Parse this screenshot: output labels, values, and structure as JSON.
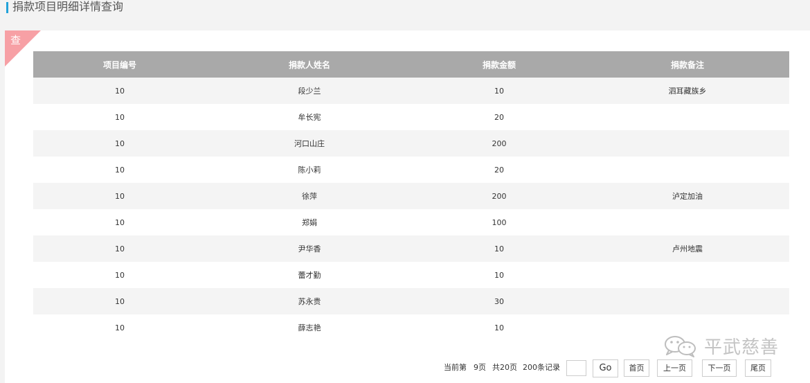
{
  "header": {
    "title": "捐款项目明细详情查询"
  },
  "ribbon": {
    "label": "查"
  },
  "table": {
    "columns": [
      "项目编号",
      "捐款人姓名",
      "捐款金额",
      "捐款备注"
    ],
    "rows": [
      [
        "10",
        "段少兰",
        "10",
        "泗耳藏族乡"
      ],
      [
        "10",
        "牟长宪",
        "20",
        ""
      ],
      [
        "10",
        "河口山庄",
        "200",
        ""
      ],
      [
        "10",
        "陈小莉",
        "20",
        ""
      ],
      [
        "10",
        "徐萍",
        "200",
        "泸定加油"
      ],
      [
        "10",
        "郑娟",
        "100",
        ""
      ],
      [
        "10",
        "尹华香",
        "10",
        "卢州地震"
      ],
      [
        "10",
        "蕾才勤",
        "10",
        ""
      ],
      [
        "10",
        "苏永贵",
        "30",
        ""
      ],
      [
        "10",
        "薛志艳",
        "10",
        ""
      ]
    ]
  },
  "watermark": {
    "text": "平武慈善",
    "icon": "wechat-icon"
  },
  "pager": {
    "current_label": "当前第",
    "current_page": "9页",
    "total_pages": "共20页",
    "total_records": "200条记录",
    "page_input_value": "",
    "go_label": "Go",
    "first_label": "首页",
    "prev_label": "上一页",
    "next_label": "下一页",
    "last_label": "尾页"
  }
}
